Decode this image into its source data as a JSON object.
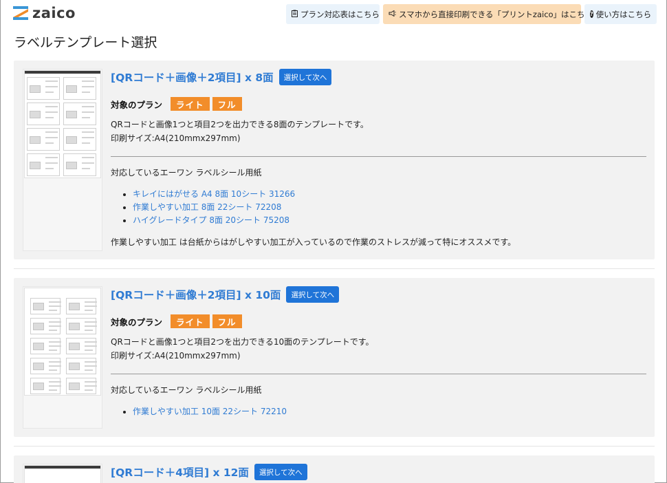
{
  "header": {
    "logo_text": "zaico",
    "plan_button": "プラン対応表はこちら",
    "print_button": "スマホから直接印刷できる「プリントzaico」はこちら",
    "help_button": "使い方はこちら"
  },
  "page_title": "ラベルテンプレート選択",
  "templates": [
    {
      "name": "[QRコード＋画像＋2項目] x 8面",
      "select_label": "選択して次へ",
      "plans_label": "対象のプラン",
      "plans": [
        "ライト",
        "フル"
      ],
      "desc1": "QRコードと画像1つと項目2つを出力できる8面のテンプレートです。",
      "desc2": "印刷サイズ:A4(210mmx297mm)",
      "compat_label": "対応しているエーワン ラベルシール用紙",
      "papers": [
        "キレイにはがせる A4 8面 10シート 31266",
        "作業しやすい加工 8面 22シート 72208",
        "ハイグレードタイプ 8面 20シート 75208"
      ],
      "note": "作業しやすい加工 は台紙からはがしやすい加工が入っているので作業のストレスが減って特にオススメです。"
    },
    {
      "name": "[QRコード＋画像＋2項目] x 10面",
      "select_label": "選択して次へ",
      "plans_label": "対象のプラン",
      "plans": [
        "ライト",
        "フル"
      ],
      "desc1": "QRコードと画像1つと項目2つを出力できる10面のテンプレートです。",
      "desc2": "印刷サイズ:A4(210mmx297mm)",
      "compat_label": "対応しているエーワン ラベルシール用紙",
      "papers": [
        "作業しやすい加工 10面 22シート 72210"
      ]
    },
    {
      "name": "[QRコード＋4項目] x 12面",
      "select_label": "選択して次へ"
    }
  ],
  "colors": {
    "brand_blue": "#2f7bd3",
    "button_blue": "#1f74d8",
    "plan_orange": "#f28d2a"
  }
}
